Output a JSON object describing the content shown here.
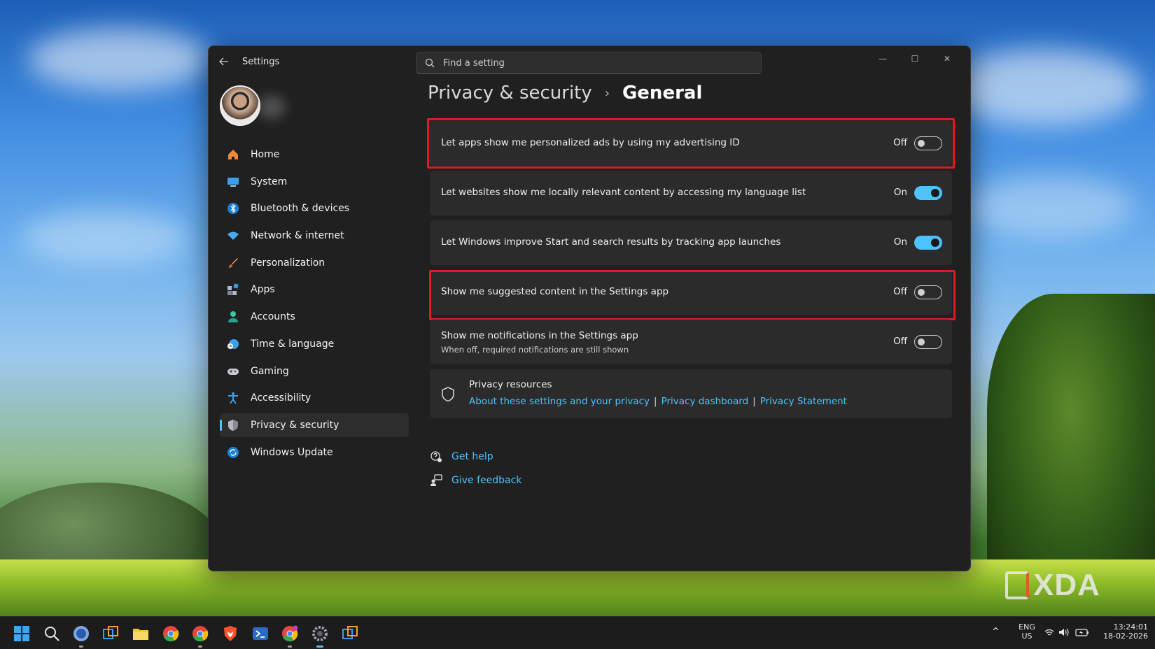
{
  "window": {
    "title": "Settings",
    "search_placeholder": "Find a setting",
    "controls": {
      "minimize": "—",
      "maximize": "☐",
      "close": "✕"
    }
  },
  "sidebar": {
    "items": [
      {
        "label": "Home",
        "icon": "home-icon",
        "active": false
      },
      {
        "label": "System",
        "icon": "system-icon",
        "active": false
      },
      {
        "label": "Bluetooth & devices",
        "icon": "bluetooth-icon",
        "active": false
      },
      {
        "label": "Network & internet",
        "icon": "wifi-icon",
        "active": false
      },
      {
        "label": "Personalization",
        "icon": "brush-icon",
        "active": false
      },
      {
        "label": "Apps",
        "icon": "apps-icon",
        "active": false
      },
      {
        "label": "Accounts",
        "icon": "accounts-icon",
        "active": false
      },
      {
        "label": "Time & language",
        "icon": "clock-globe-icon",
        "active": false
      },
      {
        "label": "Gaming",
        "icon": "gamepad-icon",
        "active": false
      },
      {
        "label": "Accessibility",
        "icon": "accessibility-icon",
        "active": false
      },
      {
        "label": "Privacy & security",
        "icon": "shield-icon",
        "active": true
      },
      {
        "label": "Windows Update",
        "icon": "update-icon",
        "active": false
      }
    ]
  },
  "breadcrumb": {
    "parent": "Privacy & security",
    "separator": "›",
    "current": "General"
  },
  "settings": [
    {
      "label": "Let apps show me personalized ads by using my advertising ID",
      "state": "Off",
      "on": false,
      "highlighted": true
    },
    {
      "label": "Let websites show me locally relevant content by accessing my language list",
      "state": "On",
      "on": true,
      "highlighted": false
    },
    {
      "label": "Let Windows improve Start and search results by tracking app launches",
      "state": "On",
      "on": true,
      "highlighted": false
    },
    {
      "label": "Show me suggested content in the Settings app",
      "state": "Off",
      "on": false,
      "highlighted": true
    },
    {
      "label": "Show me notifications in the Settings app",
      "sublabel": "When off, required notifications are still shown",
      "state": "Off",
      "on": false,
      "highlighted": false
    }
  ],
  "privacy_resources": {
    "title": "Privacy resources",
    "links": [
      "About these settings and your privacy",
      "Privacy dashboard",
      "Privacy Statement"
    ],
    "separator": "|"
  },
  "help": {
    "get_help": "Get help",
    "give_feedback": "Give feedback"
  },
  "watermark": "XDA",
  "taskbar": {
    "language": "ENG",
    "region": "US",
    "time": "13:24:01",
    "date": "18-02-2026",
    "tray_chevron": "^"
  },
  "colors": {
    "accent": "#4cc2ff",
    "highlight": "#e01a22",
    "window_bg": "#202020",
    "card_bg": "#2b2b2b"
  }
}
